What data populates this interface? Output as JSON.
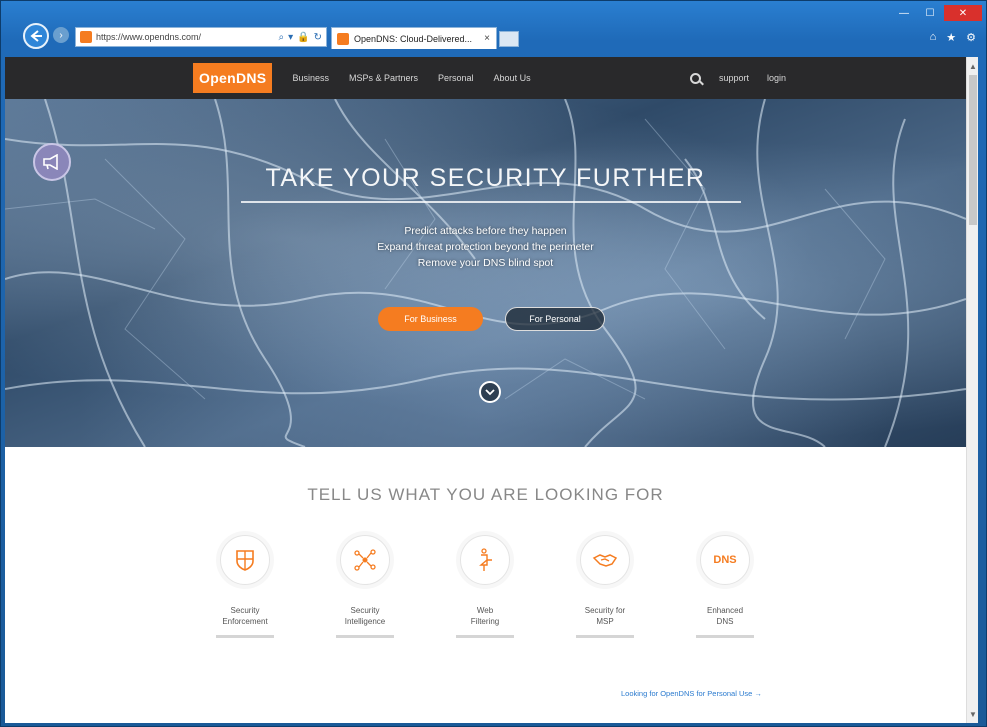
{
  "browser": {
    "address_url": "https://www.opendns.com/",
    "tab_title": "OpenDNS: Cloud-Delivered...",
    "tab_close": "×",
    "forward_glyph": "›",
    "address_tools": [
      "⌕",
      "▾",
      "🔒",
      "↻"
    ],
    "window_controls": [
      "—",
      "☐",
      "✕"
    ],
    "toolbar_icons": [
      "⌂",
      "★",
      "⚙"
    ]
  },
  "site": {
    "logo": "OpenDNS",
    "nav": [
      "Business",
      "MSPs & Partners",
      "Personal",
      "About Us"
    ],
    "support": "support",
    "login": "login"
  },
  "hero": {
    "title": "TAKE YOUR SECURITY FURTHER",
    "lines": [
      "Predict attacks before they happen",
      "Expand threat protection beyond the perimeter",
      "Remove your DNS blind spot"
    ],
    "btn_business": "For Business",
    "btn_personal": "For Personal"
  },
  "section": {
    "title": "TELL US WHAT YOU ARE LOOKING FOR",
    "cards": [
      {
        "icon": "shield-icon",
        "line1": "Security",
        "line2": "Enforcement"
      },
      {
        "icon": "network-icon",
        "line1": "Security",
        "line2": "Intelligence"
      },
      {
        "icon": "filter-icon",
        "line1": "Web",
        "line2": "Filtering"
      },
      {
        "icon": "handshake-icon",
        "line1": "Security for",
        "line2": "MSP"
      },
      {
        "icon": "dns-icon",
        "line1": "Enhanced",
        "line2": "DNS",
        "glyph": "DNS"
      }
    ],
    "bottom_link": "Looking for OpenDNS for Personal Use →"
  },
  "colors": {
    "accent": "#f57c20",
    "nav_bg": "#29292b",
    "link": "#2b7bcf"
  }
}
